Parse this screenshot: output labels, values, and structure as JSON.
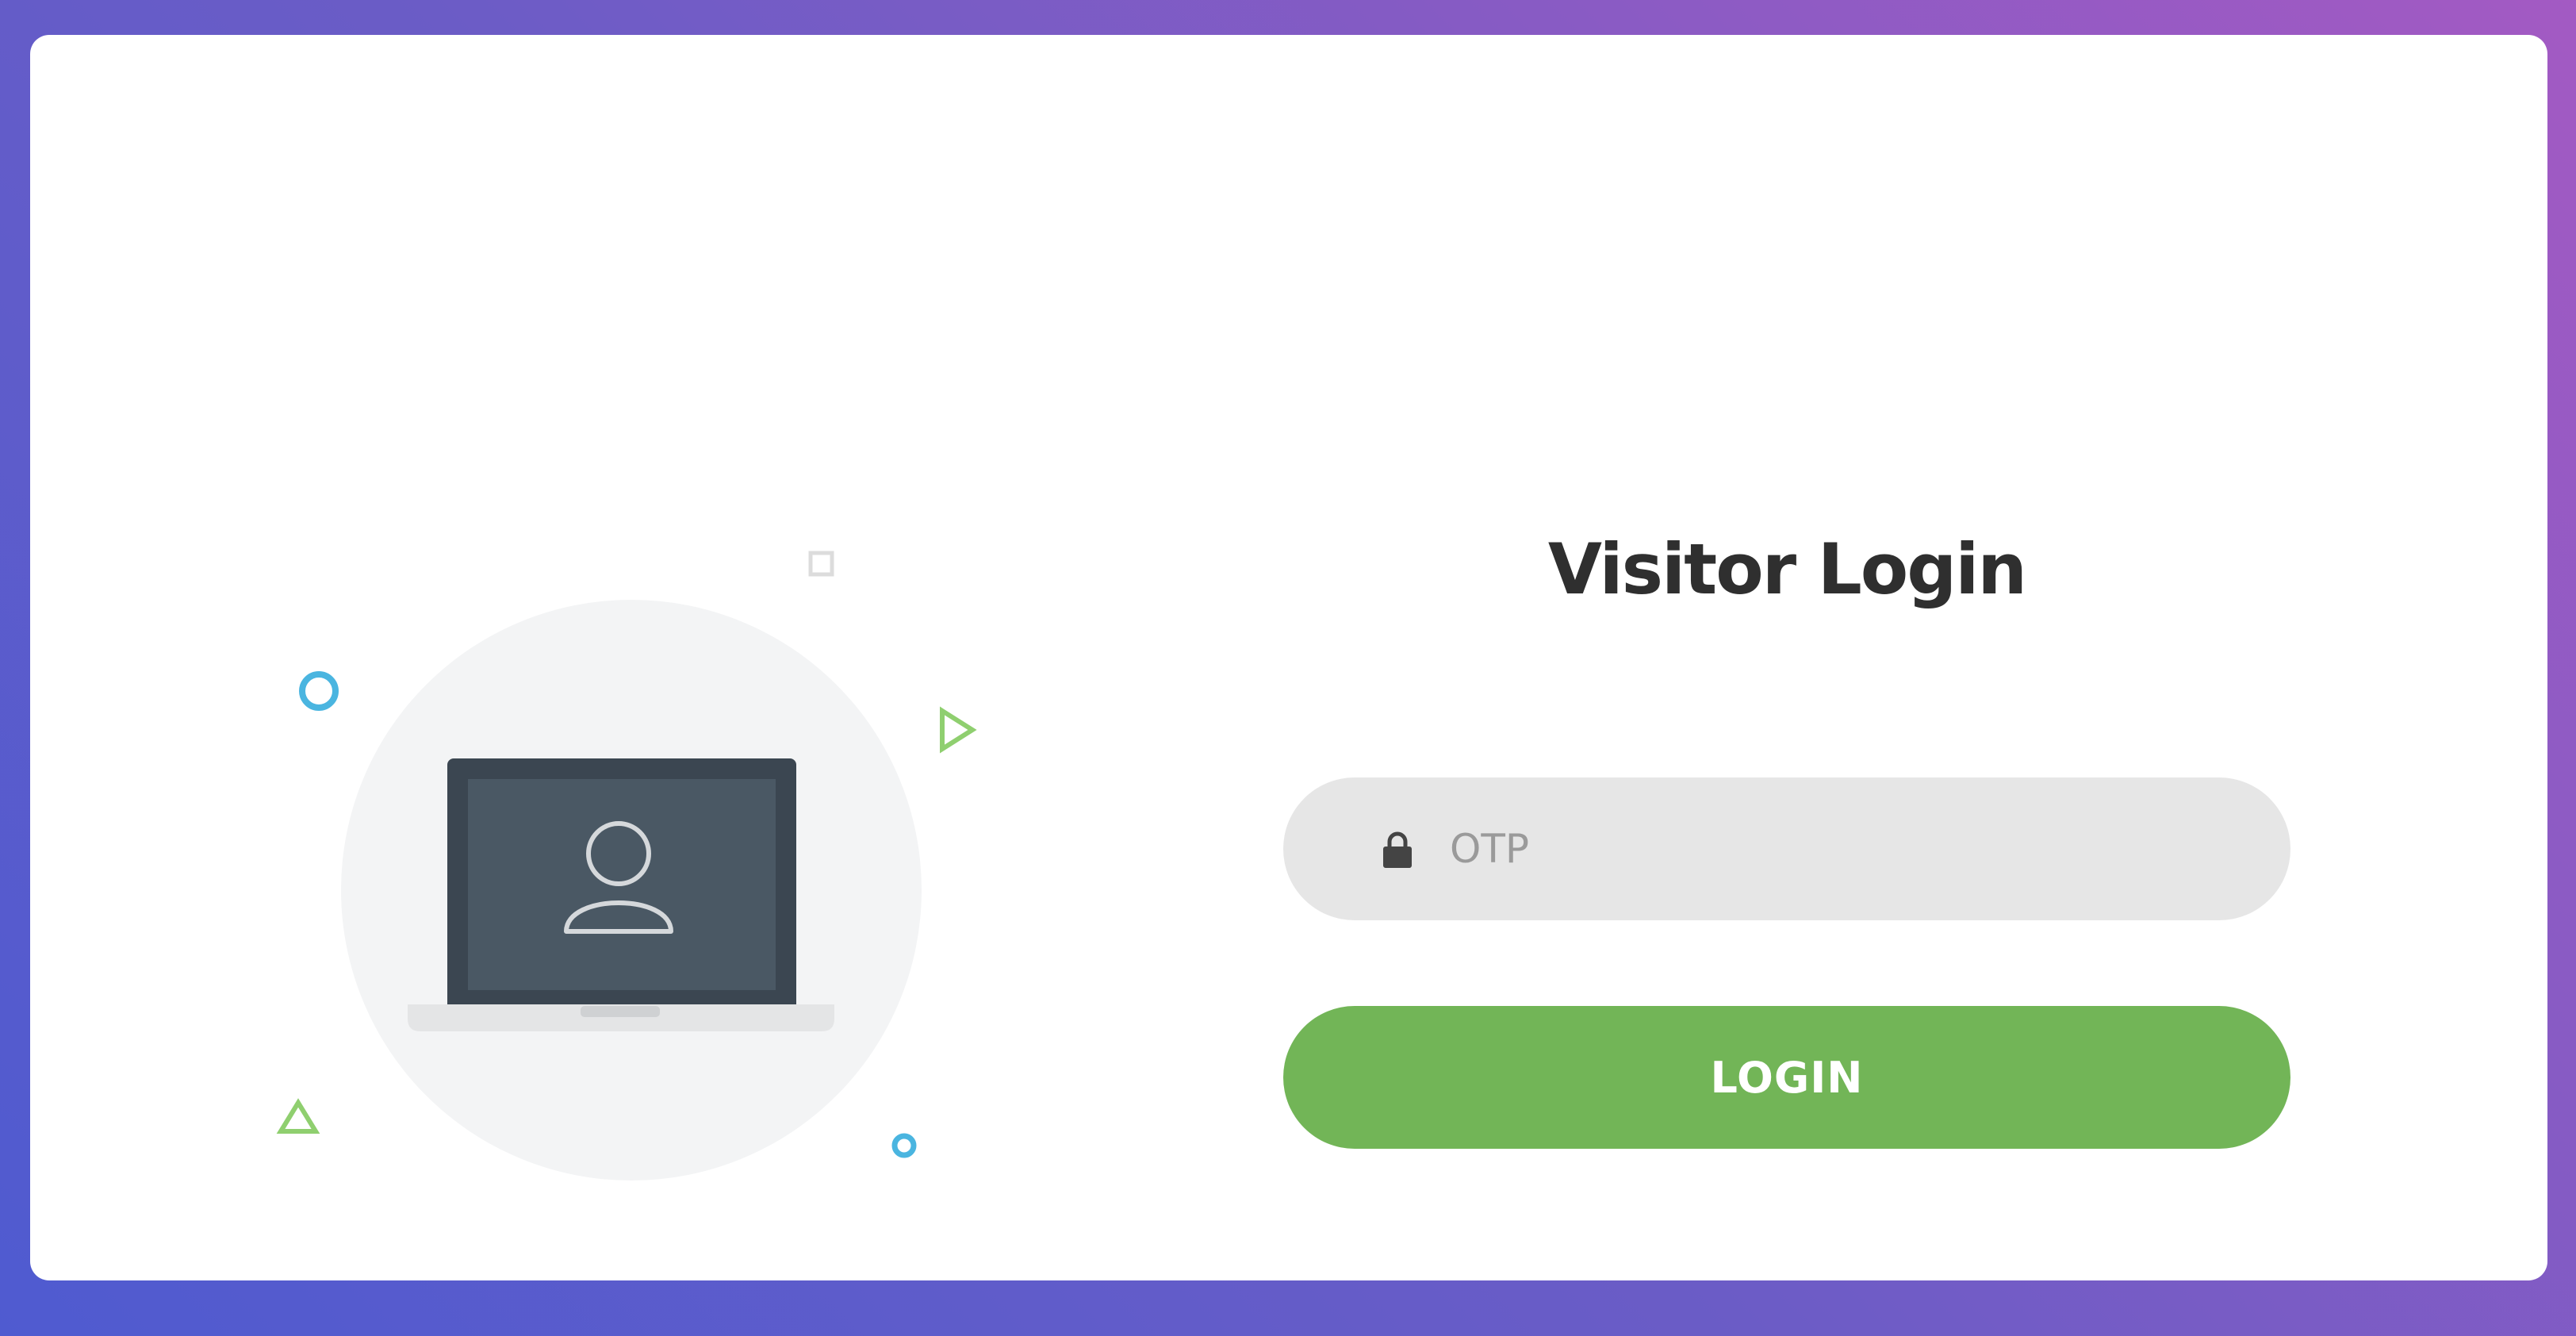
{
  "header": {
    "title": "Visitor Login"
  },
  "form": {
    "otp_placeholder": "OTP",
    "otp_value": "",
    "login_label": "LOGIN"
  },
  "icons": {
    "field_icon": "lock-icon",
    "illustration": "laptop-user-icon"
  },
  "colors": {
    "accent": "#72b557",
    "field_bg": "#e6e6e6",
    "title": "#2f2f2f",
    "background_start": "#4f5bd0",
    "background_end": "#a35ac3",
    "decor_blue": "#4ab5e0",
    "decor_green": "#8fcf6f"
  }
}
